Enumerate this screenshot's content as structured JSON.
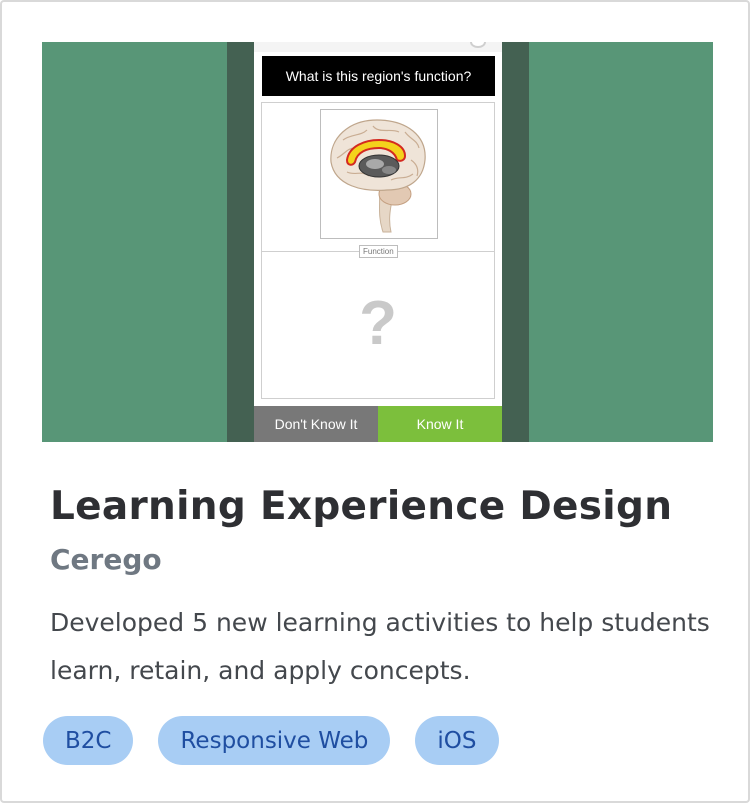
{
  "project": {
    "title": "Learning Experience Design",
    "company": "Cerego",
    "description": "Developed 5 new learning activities to help students learn, retain, and apply concepts.",
    "tags": [
      "B2C",
      "Responsive Web",
      "iOS"
    ]
  },
  "screenshot": {
    "question": "What is this region's function?",
    "image_tag": "Function",
    "placeholder_symbol": "?",
    "buttons": {
      "dont_know": "Don't Know It",
      "know": "Know It"
    }
  },
  "colors": {
    "hero_background": "#589677",
    "phone_bezel": "#446152",
    "know_button": "#7cbf3c",
    "dont_know_button": "#787878",
    "tag_background": "#a8cdf4",
    "tag_text": "#1f4ea1"
  },
  "icons": {
    "brain_image": "brain-illustration"
  }
}
